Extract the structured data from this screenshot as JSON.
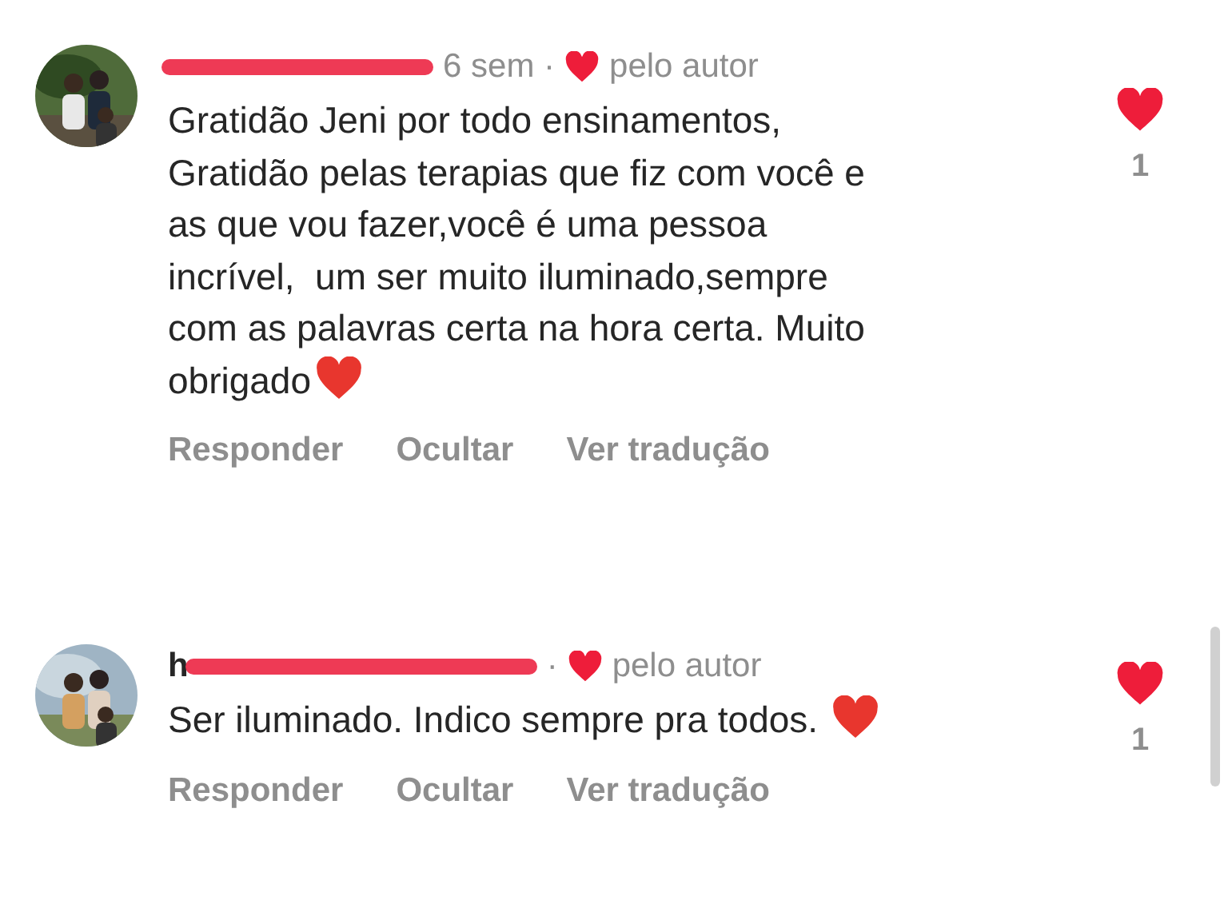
{
  "comments": [
    {
      "time": "6 sem ·",
      "liked_by_author": true,
      "author_label": "pelo autor",
      "lines": [
        "Gratidão Jeni por todo ensinamentos,",
        "Gratidão pelas terapias que fiz com você e",
        "as que vou fazer,você é uma pessoa",
        "incrível,  um ser muito iluminado,sempre",
        "com as palavras certa na hora certa. Muito",
        "obrigado"
      ],
      "ends_with_heart_emoji": true,
      "actions": [
        "Responder",
        "Ocultar",
        "Ver tradução"
      ],
      "liked": true,
      "like_count": "1"
    },
    {
      "username": "h",
      "time": "·",
      "liked_by_author": true,
      "author_label": "pelo autor",
      "lines": [
        "Ser iluminado. Indico sempre pra todos. "
      ],
      "ends_with_heart_emoji": true,
      "actions": [
        "Responder",
        "Ocultar",
        "Ver tradução"
      ],
      "liked": true,
      "like_count": "1"
    }
  ]
}
